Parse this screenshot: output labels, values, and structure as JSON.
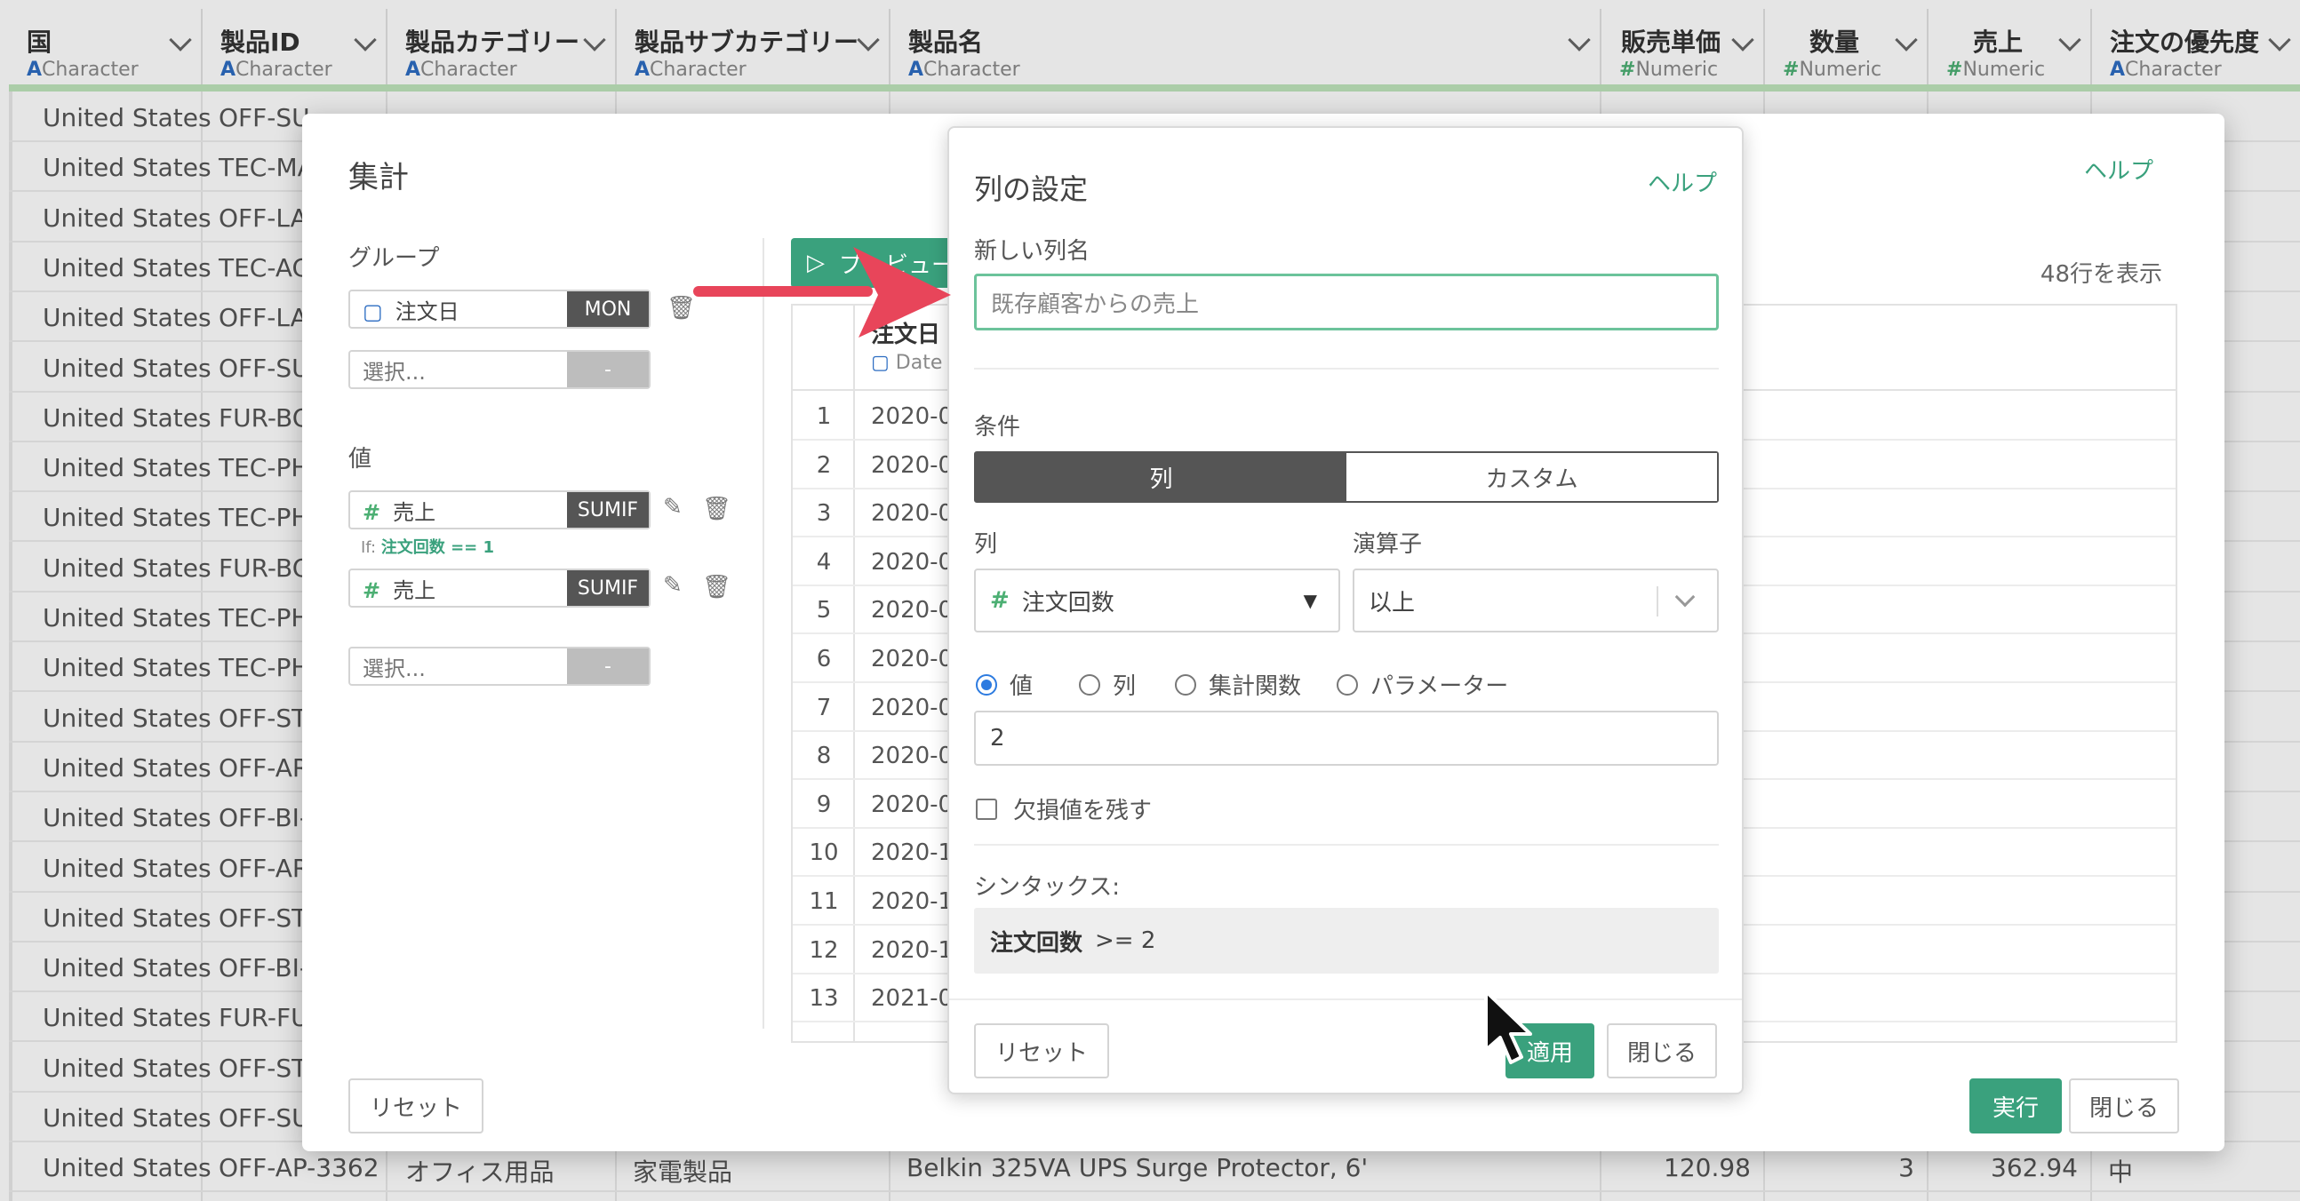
{
  "grid": {
    "columns": [
      {
        "name": "国",
        "type_icon": "A",
        "type": "Character"
      },
      {
        "name": "製品ID",
        "type_icon": "A",
        "type": "Character"
      },
      {
        "name": "製品カテゴリー",
        "type_icon": "A",
        "type": "Character"
      },
      {
        "name": "製品サブカテゴリー",
        "type_icon": "A",
        "type": "Character"
      },
      {
        "name": "製品名",
        "type_icon": "A",
        "type": "Character"
      },
      {
        "name": "販売単価",
        "type_icon": "#",
        "type": "Numeric"
      },
      {
        "name": "数量",
        "type_icon": "#",
        "type": "Numeric"
      },
      {
        "name": "売上",
        "type_icon": "#",
        "type": "Numeric"
      },
      {
        "name": "注文の優先度",
        "type_icon": "A",
        "type": "Character"
      }
    ],
    "rows": [
      {
        "country": "United States",
        "pid": "OFF-SU"
      },
      {
        "country": "United States",
        "pid": "TEC-MA"
      },
      {
        "country": "United States",
        "pid": "OFF-LA"
      },
      {
        "country": "United States",
        "pid": "TEC-AC"
      },
      {
        "country": "United States",
        "pid": "OFF-LA"
      },
      {
        "country": "United States",
        "pid": "OFF-SU"
      },
      {
        "country": "United States",
        "pid": "FUR-BO"
      },
      {
        "country": "United States",
        "pid": "TEC-PH"
      },
      {
        "country": "United States",
        "pid": "TEC-PH"
      },
      {
        "country": "United States",
        "pid": "FUR-BO"
      },
      {
        "country": "United States",
        "pid": "TEC-PH"
      },
      {
        "country": "United States",
        "pid": "TEC-PH"
      },
      {
        "country": "United States",
        "pid": "OFF-ST"
      },
      {
        "country": "United States",
        "pid": "OFF-AR"
      },
      {
        "country": "United States",
        "pid": "OFF-BI-"
      },
      {
        "country": "United States",
        "pid": "OFF-AR"
      },
      {
        "country": "United States",
        "pid": "OFF-ST"
      },
      {
        "country": "United States",
        "pid": "OFF-BI-"
      },
      {
        "country": "United States",
        "pid": "FUR-FU"
      },
      {
        "country": "United States",
        "pid": "OFF-ST"
      },
      {
        "country": "United States",
        "pid": "OFF-SU"
      }
    ],
    "last_row": {
      "country": "United States",
      "pid": "OFF-AP-3362",
      "category": "オフィス用品",
      "subcategory": "家電製品",
      "product": "Belkin 325VA UPS Surge Protector, 6'",
      "price": "120.98",
      "qty": "3",
      "sales": "362.94",
      "priority": "中"
    }
  },
  "aggregate": {
    "title": "集計",
    "help": "ヘルプ",
    "group_label": "グループ",
    "group_field": "注文日",
    "group_func": "MON",
    "select_placeholder": "選択...",
    "select_tag": "-",
    "value_label": "値",
    "values": [
      {
        "field": "売上",
        "func": "SUMIF",
        "condition_prefix": "If:",
        "condition": "注文回数 == 1"
      },
      {
        "field": "売上",
        "func": "SUMIF"
      }
    ],
    "preview_label": "プレビュー",
    "rows_count": "48行を表示",
    "preview_col_name": "注文日",
    "preview_col_type": "Date",
    "preview_rows": [
      {
        "i": "1",
        "v": "2020-0"
      },
      {
        "i": "2",
        "v": "2020-0"
      },
      {
        "i": "3",
        "v": "2020-0"
      },
      {
        "i": "4",
        "v": "2020-0"
      },
      {
        "i": "5",
        "v": "2020-0"
      },
      {
        "i": "6",
        "v": "2020-0"
      },
      {
        "i": "7",
        "v": "2020-0"
      },
      {
        "i": "8",
        "v": "2020-0"
      },
      {
        "i": "9",
        "v": "2020-0"
      },
      {
        "i": "10",
        "v": "2020-1"
      },
      {
        "i": "11",
        "v": "2020-1"
      },
      {
        "i": "12",
        "v": "2020-1"
      },
      {
        "i": "13",
        "v": "2021-0"
      }
    ],
    "reset": "リセット",
    "run": "実行",
    "close": "閉じる"
  },
  "column_settings": {
    "title": "列の設定",
    "help": "ヘルプ",
    "new_name_label": "新しい列名",
    "new_name_value": "既存顧客からの売上",
    "condition_label": "条件",
    "tab_column": "列",
    "tab_custom": "カスタム",
    "column_label": "列",
    "column_value": "注文回数",
    "operator_label": "演算子",
    "operator_value": "以上",
    "radio_value": "値",
    "radio_column": "列",
    "radio_aggregate": "集計関数",
    "radio_parameter": "パラメーター",
    "value_input": "2",
    "keep_na": "欠損値を残す",
    "syntax_label": "シンタックス:",
    "syntax_field": "注文回数",
    "syntax_expr": ">=  2",
    "reset": "リセット",
    "apply": "適用",
    "close": "閉じる"
  },
  "colors": {
    "accent_green": "#3aa17d",
    "arrow": "#e8455a",
    "header_band": "#bfe5bb"
  }
}
